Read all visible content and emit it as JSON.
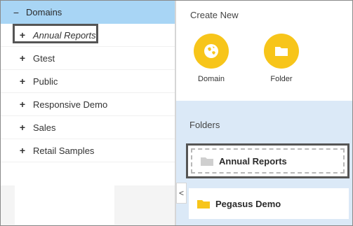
{
  "tree": {
    "root": {
      "label": "Domains",
      "toggle": "−"
    },
    "items": [
      {
        "label": "Annual Reports",
        "toggle": "+",
        "selected": true
      },
      {
        "label": "Gtest",
        "toggle": "+"
      },
      {
        "label": "Public",
        "toggle": "+"
      },
      {
        "label": "Responsive Demo",
        "toggle": "+"
      },
      {
        "label": "Sales",
        "toggle": "+"
      },
      {
        "label": "Retail Samples",
        "toggle": "+"
      }
    ]
  },
  "create_new": {
    "title": "Create New",
    "buttons": [
      {
        "label": "Domain",
        "icon": "globe-icon"
      },
      {
        "label": "Folder",
        "icon": "folder-icon"
      }
    ]
  },
  "folders": {
    "title": "Folders",
    "items": [
      {
        "label": "Annual Reports",
        "icon": "folder-gray-icon",
        "selected": true
      },
      {
        "label": "Pegasus Demo",
        "icon": "folder-yellow-icon"
      }
    ]
  },
  "collapse": {
    "glyph": "<"
  },
  "colors": {
    "tree_selected_bg": "#a8d5f5",
    "accent_yellow": "#f7c51a",
    "folders_bg": "#dbe9f7",
    "selection_outline": "#555555"
  }
}
